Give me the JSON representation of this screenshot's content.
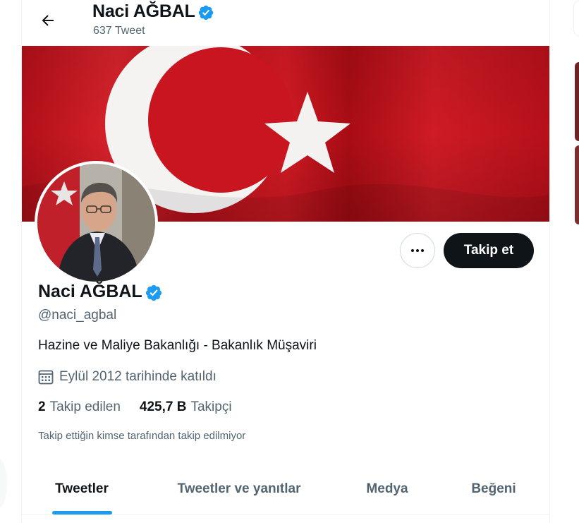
{
  "header": {
    "back_icon": "arrow-left-icon",
    "name": "Naci AĞBAL",
    "tweet_count": "637 Tweet",
    "verified_icon": "verified-badge-icon"
  },
  "profile": {
    "name": "Naci AĞBAL",
    "handle": "@naci_agbal",
    "bio": "Hazine ve Maliye Bakanlığı - Bakanlık Müşaviri",
    "joined": "Eylül 2012 tarihinde katıldı",
    "following_count": "2",
    "following_label": "Takip edilen",
    "followers_count": "425,7 B",
    "followers_label": "Takipçi",
    "followed_by_note": "Takip ettiğin kimse tarafından takip edilmiyor"
  },
  "actions": {
    "more_icon": "more-dots-icon",
    "follow_label": "Takip et"
  },
  "tabs": [
    {
      "label": "Tweetler",
      "active": true
    },
    {
      "label": "Tweetler ve yanıtlar",
      "active": false
    },
    {
      "label": "Medya",
      "active": false
    },
    {
      "label": "Beğeni",
      "active": false
    }
  ],
  "colors": {
    "accent": "#1d9bf0",
    "text_primary": "#0f1419",
    "text_secondary": "#536471",
    "flag_red": "#d0141e",
    "follow_button": "#0f1419"
  }
}
